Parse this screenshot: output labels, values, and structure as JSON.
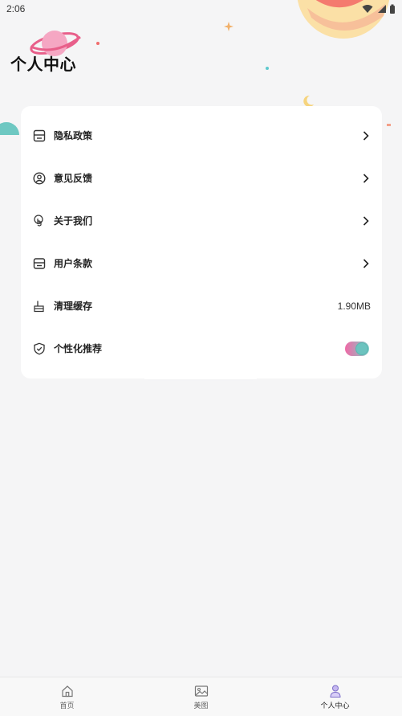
{
  "status_bar": {
    "time": "2:06"
  },
  "header": {
    "title": "个人中心"
  },
  "settings": {
    "items": [
      {
        "label": "隐私政策",
        "icon": "document-icon",
        "type": "link"
      },
      {
        "label": "意见反馈",
        "icon": "user-circle-icon",
        "type": "link"
      },
      {
        "label": "关于我们",
        "icon": "hand-touch-icon",
        "type": "link"
      },
      {
        "label": "用户条款",
        "icon": "terms-icon",
        "type": "link"
      },
      {
        "label": "清理缓存",
        "icon": "broom-icon",
        "type": "value",
        "value": "1.90MB"
      },
      {
        "label": "个性化推荐",
        "icon": "shield-check-icon",
        "type": "toggle",
        "enabled": true
      }
    ]
  },
  "bottom_nav": {
    "items": [
      {
        "label": "首页",
        "icon": "home-icon",
        "active": false
      },
      {
        "label": "美图",
        "icon": "image-icon",
        "active": false
      },
      {
        "label": "个人中心",
        "icon": "profile-icon",
        "active": true
      }
    ]
  },
  "colors": {
    "background": "#f5f5f6",
    "card": "#ffffff",
    "toggle_gradient_start": "#f069a6",
    "toggle_gradient_end": "#7fd0c9",
    "accent_pink": "#f06c6c",
    "accent_teal": "#6ec8c2"
  }
}
